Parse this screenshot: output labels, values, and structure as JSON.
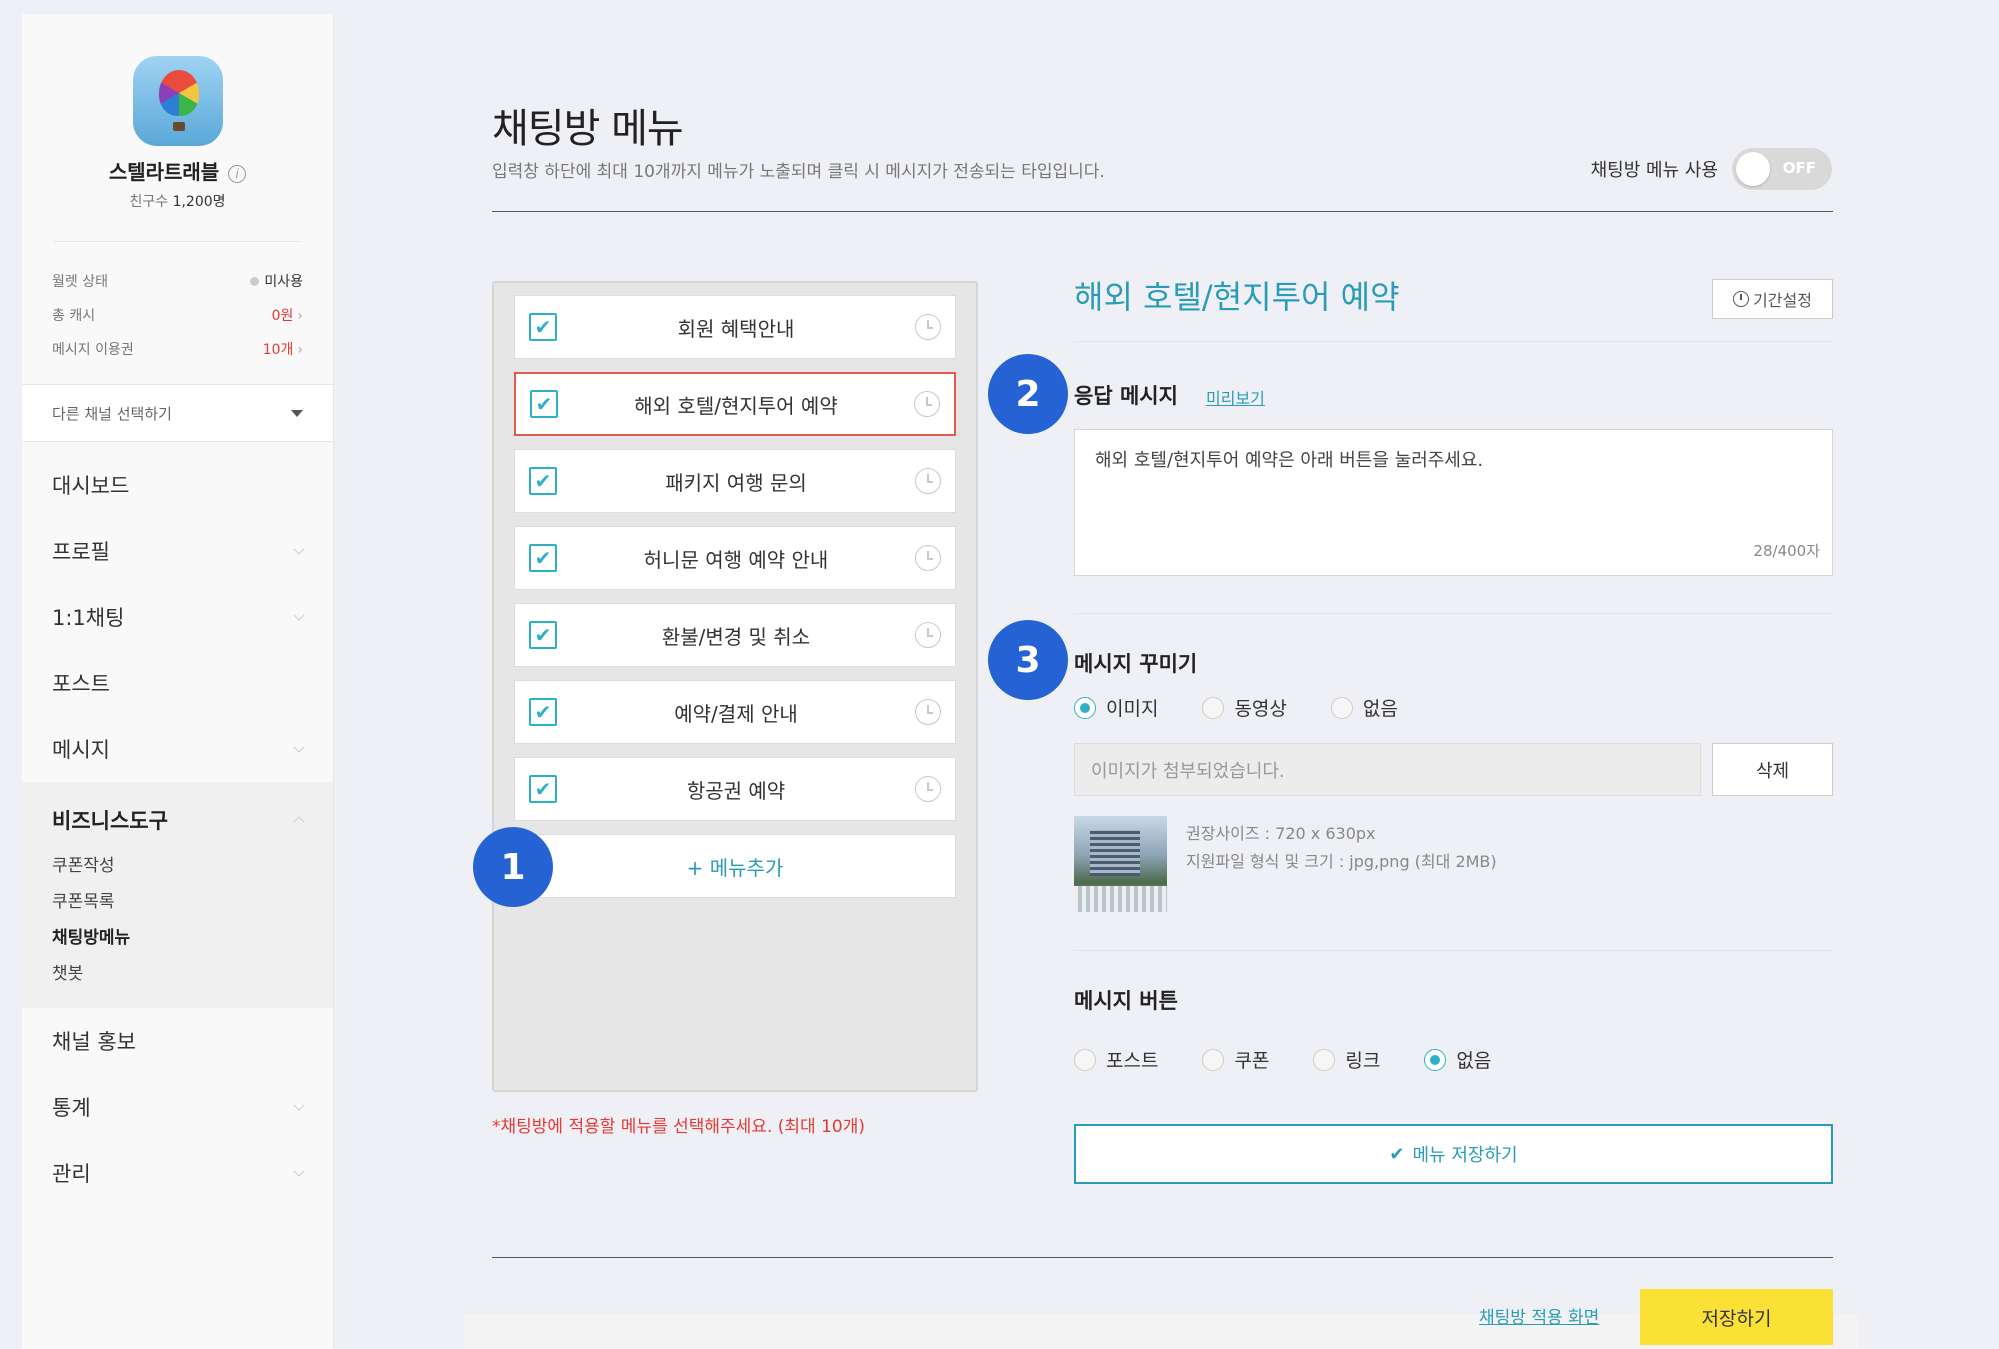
{
  "sidebar": {
    "channel_name": "스텔라트래블",
    "info_icon": "ⓘ",
    "friends_label": "친구수",
    "friends_count": "1,200명",
    "wallet": {
      "status_label": "월렛 상태",
      "status_value": "미사용",
      "cash_label": "총 캐시",
      "cash_value": "0원",
      "ticket_label": "메시지 이용권",
      "ticket_value": "10개"
    },
    "channel_select_label": "다른 채널 선택하기",
    "nav": {
      "dashboard": "대시보드",
      "profile": "프로필",
      "chat": "1:1채팅",
      "post": "포스트",
      "message": "메시지",
      "business_tools": "비즈니스도구",
      "coupon_create": "쿠폰작성",
      "coupon_list": "쿠폰목록",
      "chatroom_menu": "채팅방메뉴",
      "chatbot": "챗봇",
      "channel_promo": "채널 홍보",
      "stats": "통계",
      "manage": "관리"
    }
  },
  "header": {
    "title": "채팅방 메뉴",
    "description": "입력창 하단에 최대 10개까지 메뉴가 노출되며 클릭 시 메시지가 전송되는 타입입니다.",
    "toggle_label": "채팅방 메뉴 사용",
    "toggle_state": "OFF"
  },
  "menu_list": {
    "items": [
      {
        "label": "회원 혜택안내"
      },
      {
        "label": "해외 호텔/현지투어 예약"
      },
      {
        "label": "패키지 여행 문의"
      },
      {
        "label": "허니문 여행 예약 안내"
      },
      {
        "label": "환불/변경 및 취소"
      },
      {
        "label": "예약/결제 안내"
      },
      {
        "label": "항공권 예약"
      }
    ],
    "add_label": "+ 메뉴추가",
    "note": "*채팅방에 적용할 메뉴를 선택해주세요. (최대 10개)",
    "check_glyph": "✔"
  },
  "badges": {
    "one": "1",
    "two": "2",
    "three": "3"
  },
  "detail": {
    "title": "해외 호텔/현지투어 예약",
    "period_button": "기간설정",
    "reply_label": "응답 메시지",
    "preview_link": "미리보기",
    "reply_text": "해외 호텔/현지투어 예약은 아래 버튼을 눌러주세요.",
    "char_count": "28/400자",
    "decorate_label": "메시지 꾸미기",
    "decorate_options": {
      "image": "이미지",
      "video": "동영상",
      "none": "없음"
    },
    "attach_placeholder": "이미지가 첨부되었습니다.",
    "delete_button": "삭제",
    "image_size_info": "권장사이즈 : 720 x 630px",
    "image_format_info": "지원파일 형식 및 크기 : jpg,png (최대 2MB)",
    "button_label": "메시지 버튼",
    "button_options": {
      "post": "포스트",
      "coupon": "쿠폰",
      "link": "링크",
      "none": "없음"
    },
    "save_menu_button": "메뉴 저장하기",
    "save_menu_check": "✔"
  },
  "footer": {
    "apply_link": "채팅방 적용 화면",
    "save_button": "저장하기"
  }
}
